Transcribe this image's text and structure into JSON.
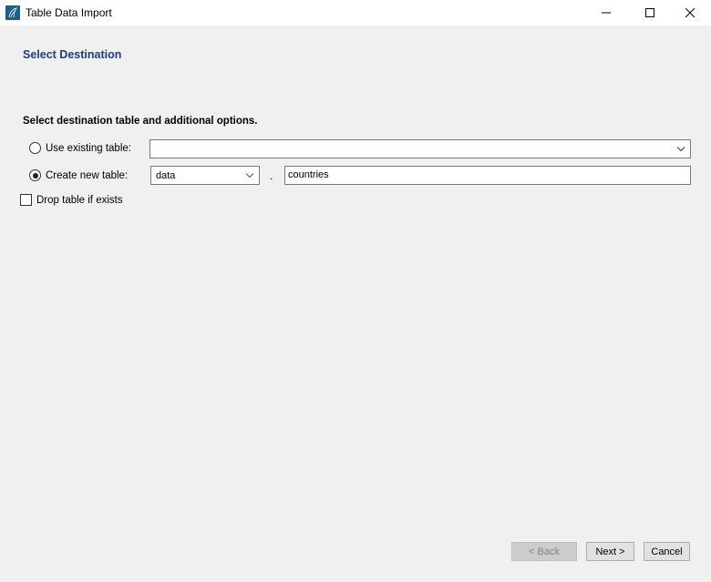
{
  "window": {
    "title": "Table Data Import",
    "icon": "mysql-workbench-dolphin-icon",
    "controls": {
      "minimize": "minimize-icon",
      "maximize": "maximize-icon",
      "close": "close-icon"
    }
  },
  "page": {
    "heading": "Select Destination",
    "section_label": "Select destination table and additional options."
  },
  "options": {
    "use_existing": {
      "label": "Use existing table:",
      "selected": false,
      "value": ""
    },
    "create_new": {
      "label": "Create new table:",
      "selected": true,
      "schema": "data",
      "separator": ".",
      "table_name": "countries"
    },
    "drop_if_exists": {
      "label": "Drop table if exists",
      "checked": false
    }
  },
  "footer": {
    "back_label": "< Back",
    "back_enabled": false,
    "next_label": "Next >",
    "cancel_label": "Cancel"
  },
  "colors": {
    "heading": "#1a3c8c",
    "background": "#f0f0f0",
    "titlebar": "#ffffff",
    "icon_bg": "#1f5f86"
  }
}
